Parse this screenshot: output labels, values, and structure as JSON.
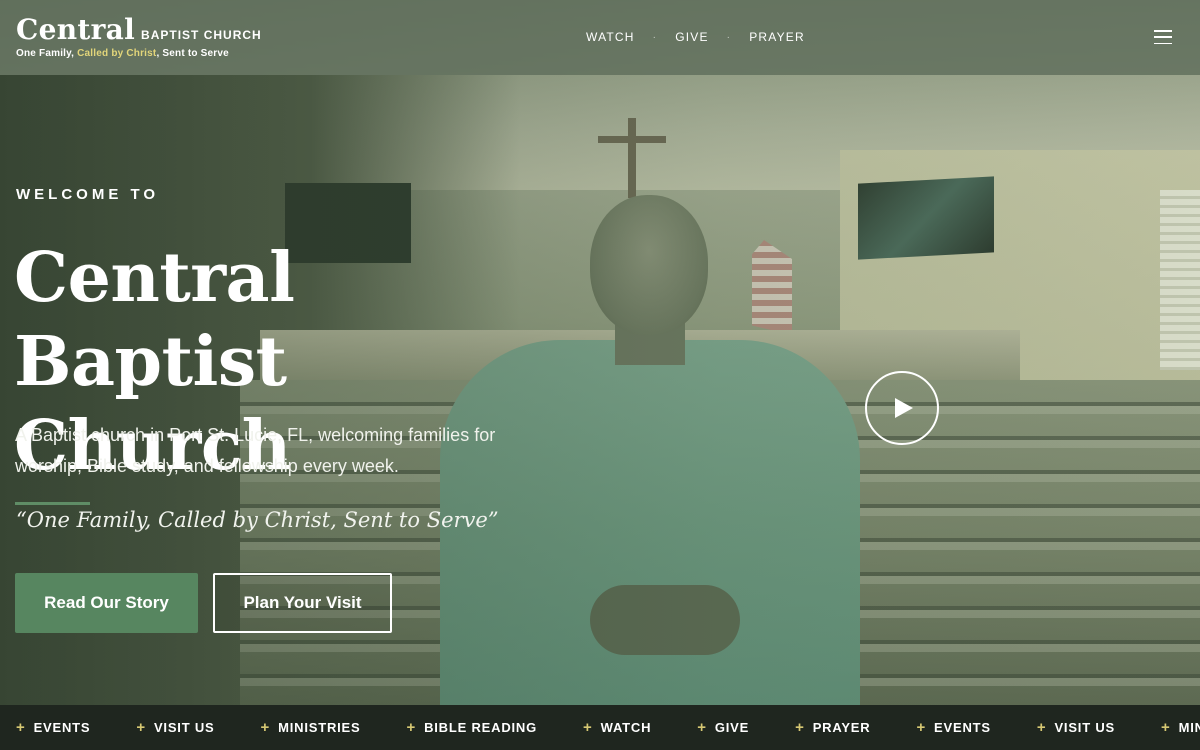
{
  "header": {
    "brand_name": "Central",
    "brand_sub": "BAPTIST CHURCH",
    "tagline_pre": "One Family, ",
    "tagline_hl": "Called by Christ",
    "tagline_post": ", Sent to Serve",
    "tagline_highlight_color": "#e2d57a",
    "nav": [
      {
        "label": "WATCH"
      },
      {
        "label": "GIVE"
      },
      {
        "label": "PRAYER"
      }
    ],
    "nav_separator": "·",
    "menu_icon": "hamburger-menu-icon"
  },
  "hero": {
    "eyebrow": "WELCOME TO",
    "title_line1": "Central Baptist",
    "title_line2": "Church",
    "description": "A Baptist church in Port St. Lucie, FL, welcoming families for worship, Bible study, and fellowship every week.",
    "motto": "“One Family, Called by Christ, Sent to Serve”",
    "primary_button": "Read Our Story",
    "secondary_button": "Plan Your Visit",
    "play_icon": "play-icon",
    "accent_color": "#578660"
  },
  "ticker": {
    "items": [
      "EVENTS",
      "VISIT US",
      "MINISTRIES",
      "BIBLE READING",
      "WATCH",
      "GIVE",
      "PRAYER",
      "EVENTS",
      "VISIT US",
      "MINISTRIES"
    ],
    "plus_glyph": "+",
    "plus_color": "#d6c873"
  }
}
